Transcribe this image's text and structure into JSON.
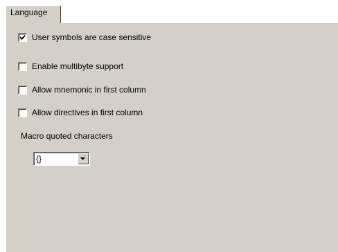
{
  "tab": {
    "label": "Language"
  },
  "options": [
    {
      "label": "User symbols are case sensitive",
      "checked": true
    },
    {
      "label": "Enable multibyte support",
      "checked": false
    },
    {
      "label": "Allow mnemonic in first column",
      "checked": false
    },
    {
      "label": "Allow directives in first column",
      "checked": false
    }
  ],
  "macro": {
    "label": "Macro quoted characters",
    "selected": "{}"
  },
  "icons": {
    "check": "checkmark-icon",
    "dropdown": "dropdown-arrow-icon"
  },
  "colors": {
    "panel": "#d4d0c8",
    "highlight": "#ffffff",
    "shadow": "#808080"
  }
}
